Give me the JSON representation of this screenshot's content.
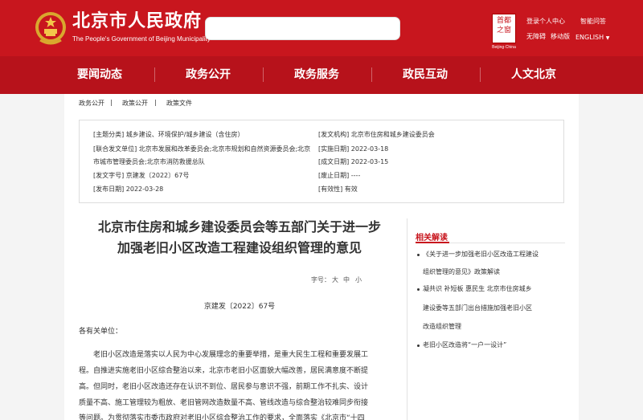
{
  "header": {
    "title": "北京市人民政府",
    "subtitle": "The People's Government of Beijing Municipality",
    "search_placeholder": "",
    "seal_line1": "首都",
    "seal_line2": "之窗",
    "seal_caption": "Beijing·China",
    "links": {
      "login": "登录个人中心",
      "smart_qa": "智能问答",
      "accessibility": "无障碍",
      "mobile": "移动版",
      "english": "ENGLISH"
    }
  },
  "nav": [
    "要闻动态",
    "政务公开",
    "政务服务",
    "政民互动",
    "人文北京"
  ],
  "breadcrumb": [
    "政务公开",
    "政策公开",
    "政策文件"
  ],
  "meta": {
    "topic": "[主题分类] 城乡建设、环境保护/城乡建设（含住房）",
    "issuer": "[发文机构] 北京市住房和城乡建设委员会",
    "joint_1": "[联合发文单位] 北京市发展和改革委员会;北京市规划和自然资源委员会;北京",
    "joint_2": "市城市管理委员会;北京市消防救援总队",
    "effective": "[实施日期] 2022-03-18",
    "created": "[成文日期] 2022-03-15",
    "doc_no": "[发文字号] 京建发〔2022〕67号",
    "repeal": "[废止日期] ----",
    "publish": "[发布日期] 2022-03-28",
    "validity": "[有效性] 有效"
  },
  "document": {
    "title_line1": "北京市住房和城乡建设委员会等五部门关于进一步",
    "title_line2": "加强老旧小区改造工程建设组织管理的意见",
    "font_label": "字号：",
    "font_large": "大",
    "font_medium": "中",
    "font_small": "小",
    "doc_number": "京建发〔2022〕67号",
    "salutation": "各有关单位：",
    "para_lines": [
      "老旧小区改造是落实以人民为中心发展理念的重要举措，是重大民生工程和重要发展工",
      "程。自推进实施老旧小区综合整治以来，北京市老旧小区面貌大幅改善，居民满意度不断提",
      "高。但同时，老旧小区改造还存在认识不到位、居民参与意识不强，前期工作不扎实、设计",
      "质量不高、施工管理较为粗放、老旧管网改造数量不高、管线改造与综合整治较难同步衔接",
      "等问题。为贯彻落实市委市政府对老旧小区综合整治工作的要求，全面落实《北京市“十四"
    ]
  },
  "sidebar": {
    "heading": "相关解读",
    "item1_l1": "《关于进一步加强老旧小区改造工程建设",
    "item1_l2": "组织管理的意见》政策解读",
    "item2_l1": "凝共识 补短板 惠民生 北京市住房城乡",
    "item2_l2": "建设委等五部门出台措施加强老旧小区",
    "item2_l3": "改造组织管理",
    "item3_l1": "老旧小区改造将“一户一设计”"
  }
}
